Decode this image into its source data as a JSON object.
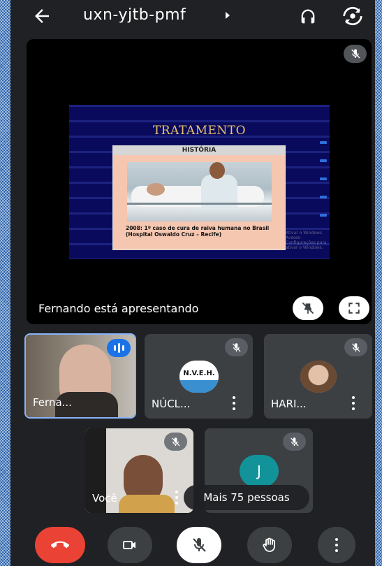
{
  "header": {
    "meeting_code": "uxn-yjtb-pmf"
  },
  "presentation": {
    "slide": {
      "title": "TRATAMENTO",
      "subtitle": "HISTÓRIA",
      "caption": "2008: 1º caso de cura de raiva humana no Brasil (Hospital Oswaldo Cruz – Recife)",
      "watermark": "Ativar o Windows\nAcesse Configurações para ativar o Windows."
    },
    "presenting_text": "Fernando está apresentando"
  },
  "participants": [
    {
      "name": "Ferna...",
      "speaking": true
    },
    {
      "name": "NÚCL...",
      "avatar_text": "N.V.E.H."
    },
    {
      "name": "HARI..."
    },
    {
      "name": "Você"
    },
    {
      "initial": "J"
    }
  ],
  "more_people": "Mais 75 pessoas",
  "colors": {
    "background": "#202124",
    "tile": "#3c4043",
    "end_call": "#ea4335",
    "speaking": "#1a73e8",
    "avatar_j": "#12939a"
  }
}
